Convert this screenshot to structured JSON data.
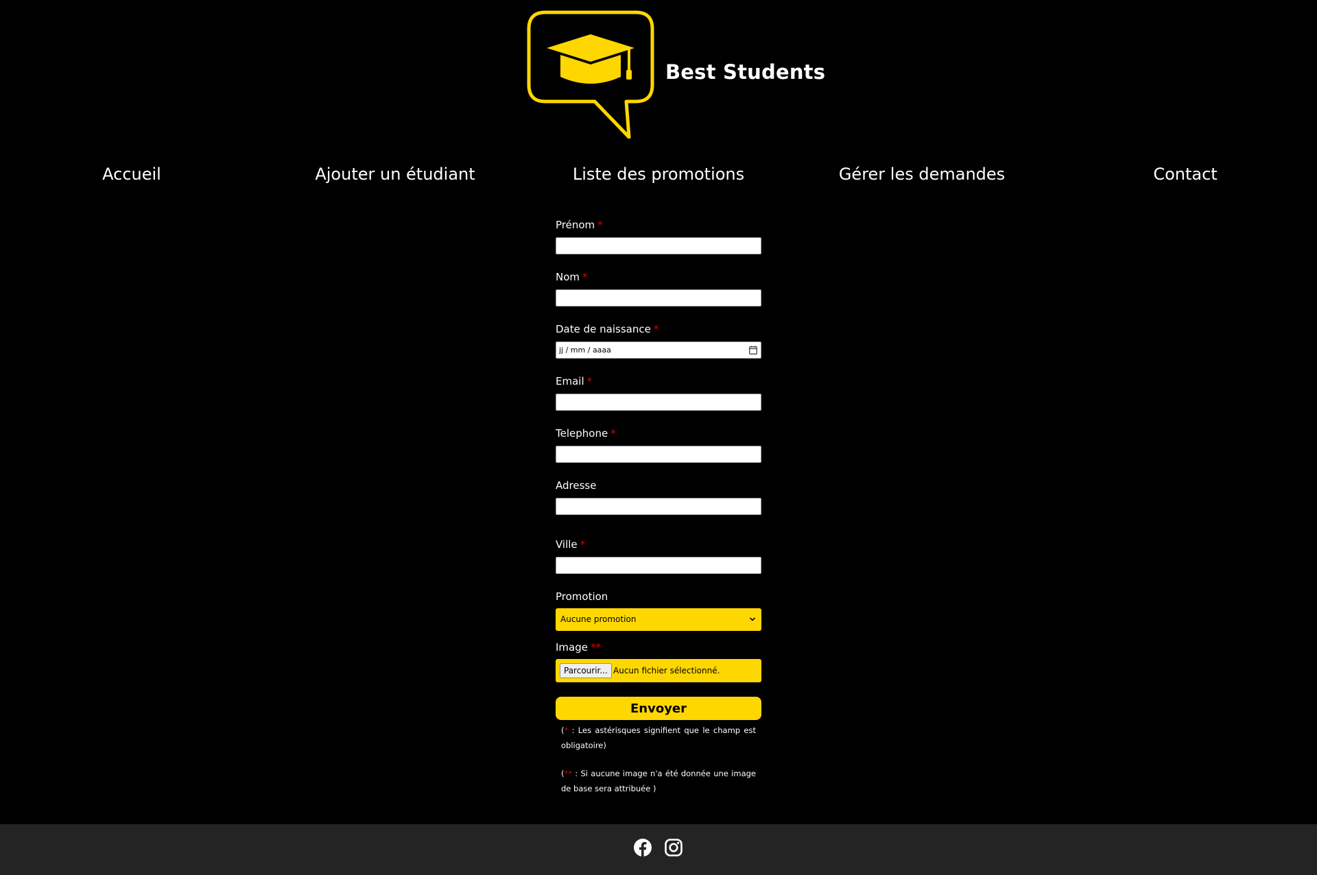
{
  "brand": {
    "name": "Best Students",
    "logo_icon": "graduation-cap-speech-bubble-icon",
    "accent": "#ffd700"
  },
  "nav": {
    "items": [
      "Accueil",
      "Ajouter un étudiant",
      "Liste des promotions",
      "Gérer les demandes",
      "Contact"
    ]
  },
  "form": {
    "firstname": {
      "label": "Prénom",
      "required": "*",
      "value": ""
    },
    "lastname": {
      "label": "Nom",
      "required": "*",
      "value": ""
    },
    "birthdate": {
      "label": "Date de naissance",
      "required": "*",
      "placeholder": "jj / mm / aaaa"
    },
    "email": {
      "label": "Email",
      "required": "*",
      "value": ""
    },
    "phone": {
      "label": "Telephone",
      "required": "*",
      "value": ""
    },
    "address": {
      "label": "Adresse",
      "value": ""
    },
    "city": {
      "label": "Ville",
      "required": "*",
      "value": ""
    },
    "promotion": {
      "label": "Promotion",
      "selected": "Aucune promotion"
    },
    "image": {
      "label": "Image",
      "required": "**",
      "browse_label": "Parcourir...",
      "status": "Aucun fichier sélectionné."
    },
    "submit_label": "Envoyer",
    "note1": {
      "open": "(",
      "mark": "*",
      "text": " : Les astérisques signifient que le champ est obligatoire)"
    },
    "note2": {
      "open": "(",
      "mark": "**",
      "text": " : Si aucune image n'a été donnée une image de base sera attribuée )"
    }
  },
  "footer": {
    "icons": [
      "facebook-icon",
      "instagram-icon"
    ],
    "background": "#242424"
  }
}
